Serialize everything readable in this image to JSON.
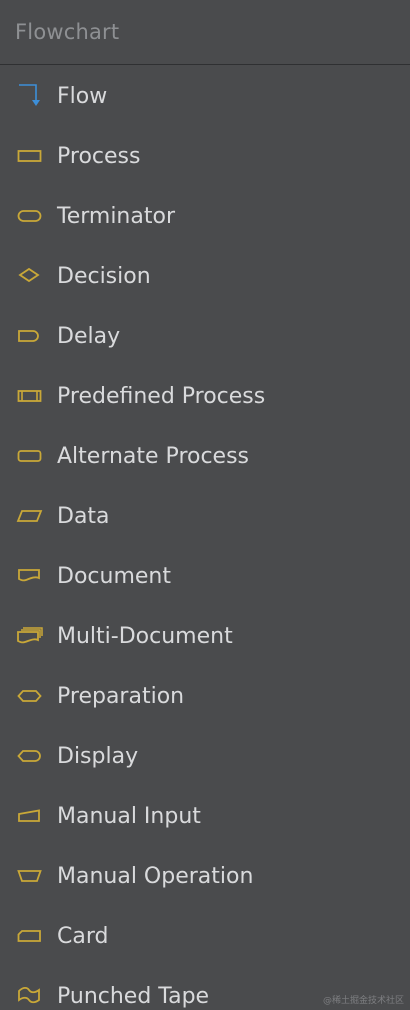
{
  "panel": {
    "title": "Flowchart"
  },
  "colors": {
    "background": "#4a4b4d",
    "shape_stroke": "#c9a838",
    "flow_stroke": "#3d8fd9",
    "label": "#d9dadc",
    "header": "#8e9093"
  },
  "items": [
    {
      "label": "Flow",
      "icon": "flow-arrow-icon"
    },
    {
      "label": "Process",
      "icon": "process-rectangle-icon"
    },
    {
      "label": "Terminator",
      "icon": "terminator-stadium-icon"
    },
    {
      "label": "Decision",
      "icon": "decision-diamond-icon"
    },
    {
      "label": "Delay",
      "icon": "delay-d-shape-icon"
    },
    {
      "label": "Predefined Process",
      "icon": "predefined-process-icon"
    },
    {
      "label": "Alternate Process",
      "icon": "alternate-process-icon"
    },
    {
      "label": "Data",
      "icon": "data-parallelogram-icon"
    },
    {
      "label": "Document",
      "icon": "document-icon"
    },
    {
      "label": "Multi-Document",
      "icon": "multi-document-icon"
    },
    {
      "label": "Preparation",
      "icon": "preparation-hexagon-icon"
    },
    {
      "label": "Display",
      "icon": "display-icon"
    },
    {
      "label": "Manual Input",
      "icon": "manual-input-icon"
    },
    {
      "label": "Manual Operation",
      "icon": "manual-operation-trapezoid-icon"
    },
    {
      "label": "Card",
      "icon": "card-icon"
    },
    {
      "label": "Punched Tape",
      "icon": "punched-tape-icon"
    }
  ],
  "watermark": "@稀土掘金技术社区"
}
